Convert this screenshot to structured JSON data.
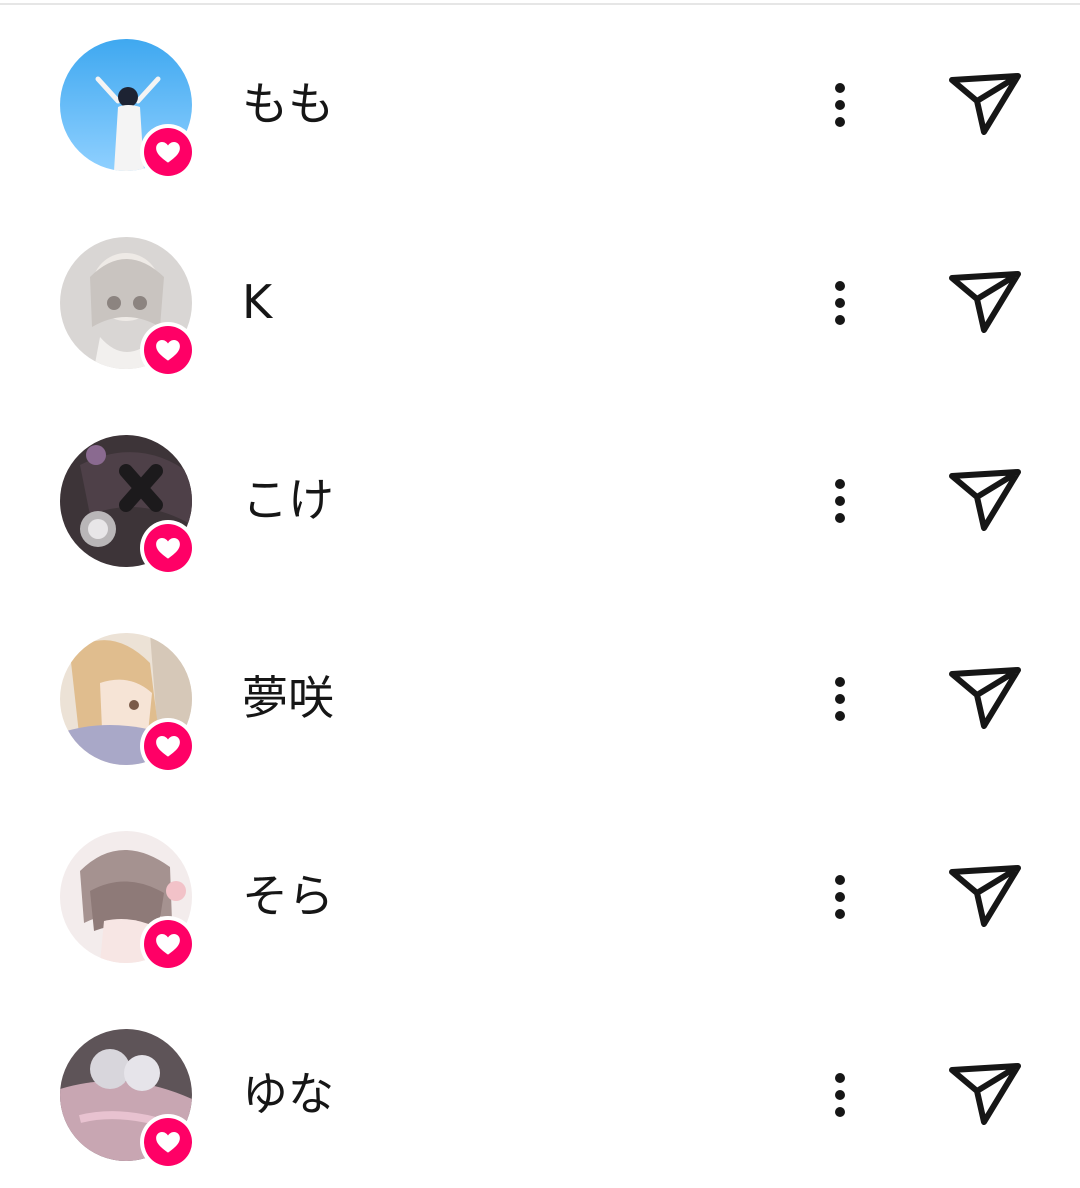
{
  "colors": {
    "badge": "#ff0066",
    "text": "#161616",
    "divider": "#e6e6e6"
  },
  "icons": {
    "badge": "heart-icon",
    "more": "more-vertical-icon",
    "send": "send-icon"
  },
  "users": [
    {
      "name": "もも"
    },
    {
      "name": "K"
    },
    {
      "name": "こけ"
    },
    {
      "name": "夢咲"
    },
    {
      "name": "そら"
    },
    {
      "name": "ゆな"
    }
  ]
}
